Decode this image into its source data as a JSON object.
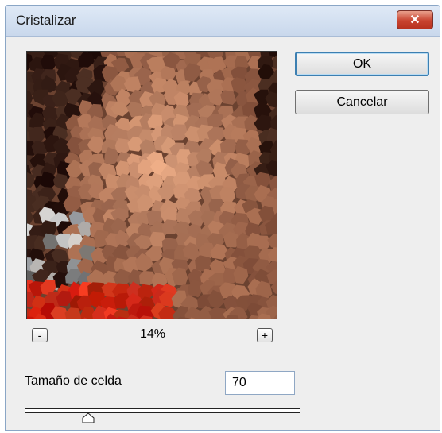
{
  "window": {
    "title": "Cristalizar",
    "close_glyph": "✕"
  },
  "buttons": {
    "ok_label": "OK",
    "cancel_label": "Cancelar"
  },
  "zoom": {
    "minus_label": "-",
    "plus_label": "+",
    "level": "14%"
  },
  "parameter": {
    "label": "Tamaño de celda",
    "value": "70",
    "slider_fraction": 0.23
  },
  "preview": {
    "description_icon": "crystallized-face-preview"
  },
  "colors": {
    "title_bar": "#c9d8ec",
    "close_button": "#c8432f",
    "ok_border": "#3c7fb1"
  }
}
